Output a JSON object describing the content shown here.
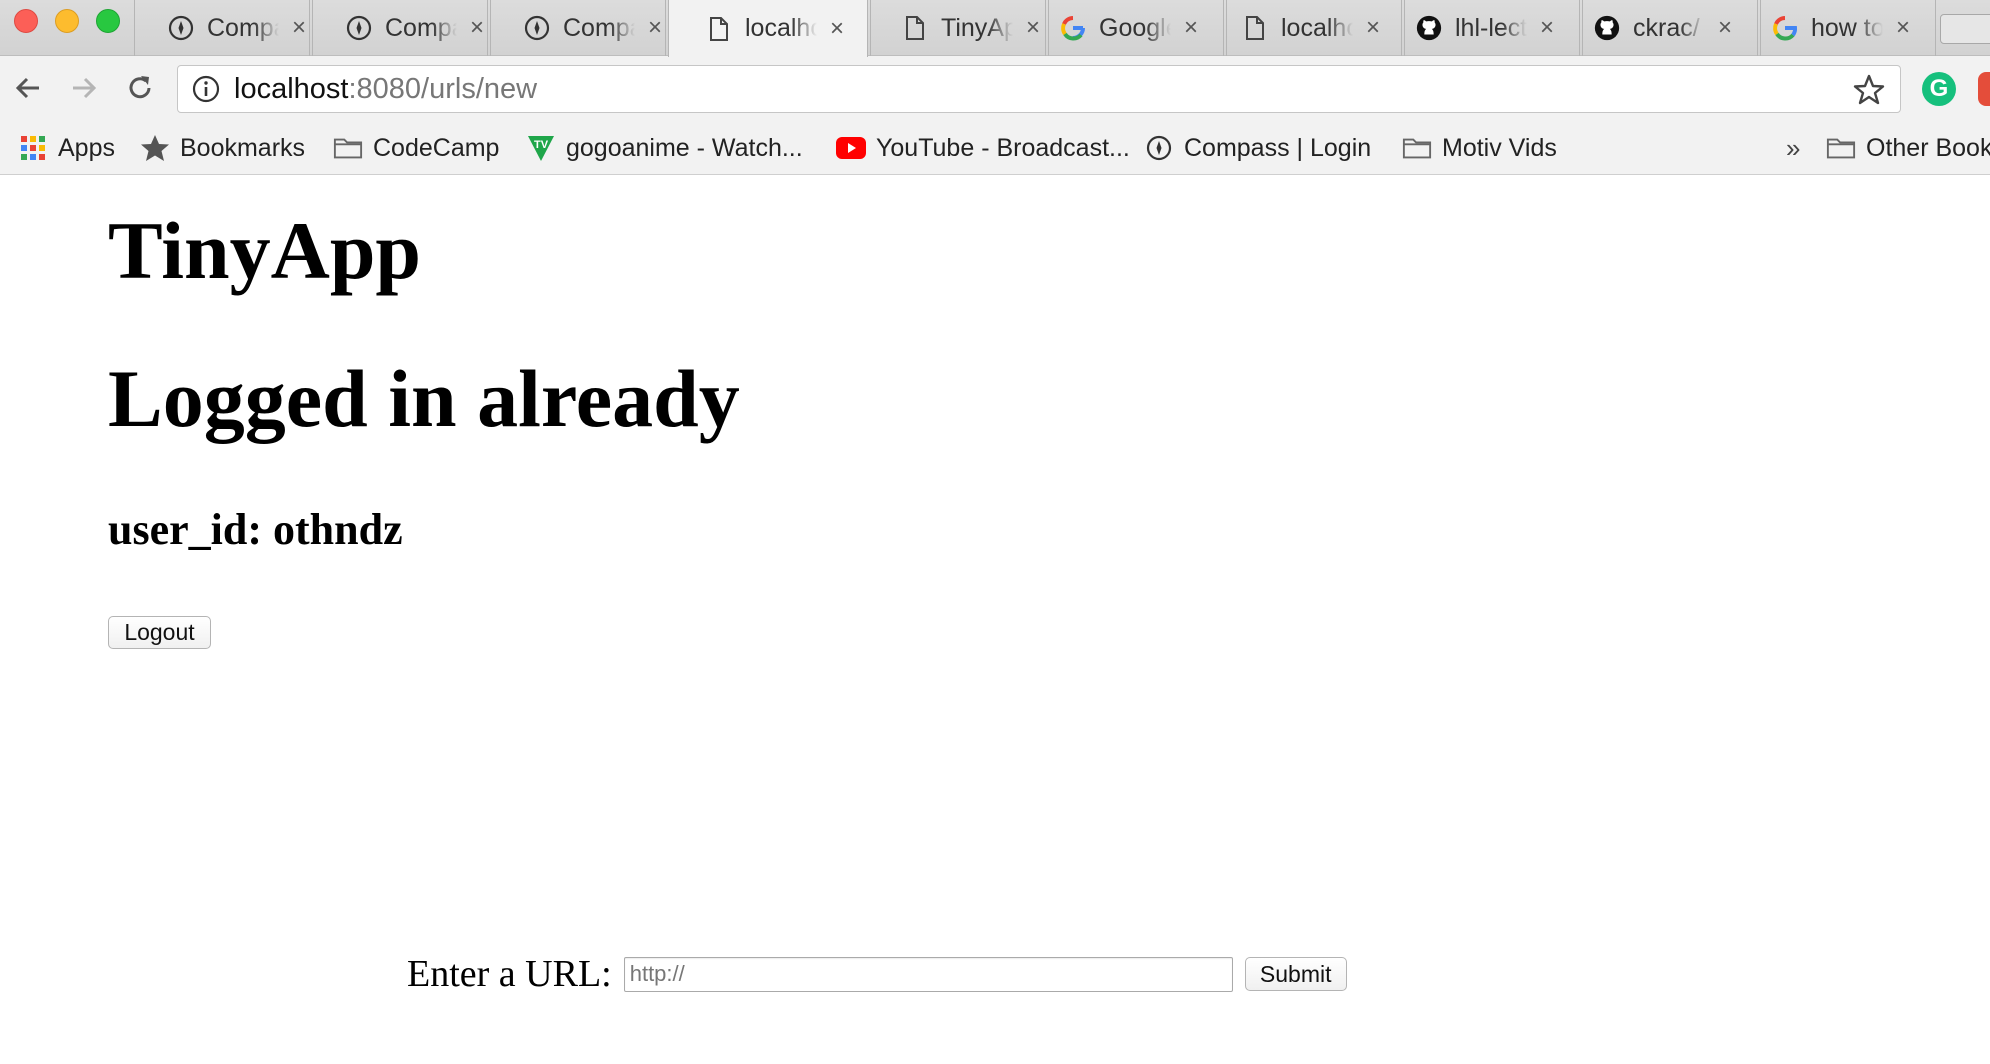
{
  "browser": {
    "tabs": [
      {
        "title": "Compass",
        "icon": "compass-icon",
        "active": false
      },
      {
        "title": "Compass",
        "icon": "compass-icon",
        "active": false
      },
      {
        "title": "Compass",
        "icon": "compass-icon",
        "active": false
      },
      {
        "title": "localhost",
        "icon": "page-icon",
        "active": true
      },
      {
        "title": "TinyApp",
        "icon": "page-icon",
        "active": false
      },
      {
        "title": "Google",
        "icon": "google-icon",
        "active": false
      },
      {
        "title": "localhost",
        "icon": "page-icon",
        "active": false
      },
      {
        "title": "lhl-lecture",
        "icon": "github-icon",
        "active": false
      },
      {
        "title": "ckrac/",
        "icon": "github-icon",
        "active": false
      },
      {
        "title": "how to",
        "icon": "google-icon",
        "active": false
      }
    ],
    "tab_close": "×",
    "address": {
      "host": "localhost",
      "rest": ":8080/urls/new"
    },
    "bookmarks": [
      {
        "label": "Apps",
        "icon": "apps-grid-icon"
      },
      {
        "label": "Bookmarks",
        "icon": "star-icon"
      },
      {
        "label": "CodeCamp",
        "icon": "folder-icon"
      },
      {
        "label": "gogoanime - Watch...",
        "icon": "gogoanime-icon"
      },
      {
        "label": "YouTube - Broadcast...",
        "icon": "youtube-icon"
      },
      {
        "label": "Compass | Login",
        "icon": "compass-icon"
      },
      {
        "label": "Motiv Vids",
        "icon": "folder-icon"
      },
      {
        "label": "Other Bookmarks",
        "icon": "folder-icon"
      }
    ],
    "overflow": "»",
    "extension_g": "G"
  },
  "page": {
    "title": "TinyApp",
    "status": "Logged in already",
    "user_line": "user_id: othndz",
    "logout_label": "Logout",
    "form": {
      "label": "Enter a URL:",
      "placeholder": "http://",
      "submit_label": "Submit"
    }
  }
}
